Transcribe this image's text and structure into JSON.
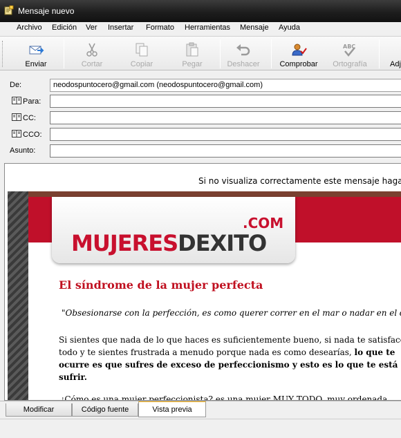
{
  "window": {
    "title": "Mensaje nuevo"
  },
  "menu": [
    "Archivo",
    "Edición",
    "Ver",
    "Insertar",
    "Formato",
    "Herramientas",
    "Mensaje",
    "Ayuda"
  ],
  "toolbar": {
    "send": "Enviar",
    "cut": "Cortar",
    "copy": "Copiar",
    "paste": "Pegar",
    "undo": "Deshacer",
    "check": "Comprobar",
    "spelling": "Ortografía",
    "attach": "Adj"
  },
  "headers": {
    "from_label": "De:",
    "from_value": "neodospuntocero@gmail.com     (neodospuntocero@gmail.com)",
    "to_label": "Para:",
    "cc_label": "CC:",
    "bcc_label": "CCO:",
    "subject_label": "Asunto:"
  },
  "body": {
    "notice": "Si no visualiza correctamente este mensaje haga",
    "logo_main_a": "MUJERES",
    "logo_main_b": "DEXITO",
    "logo_com": ".COM",
    "title": "El síndrome de la mujer perfecta",
    "quote": "\"Obsesionarse con la perfección, es como querer correr en el mar o nadar en el desierto",
    "p1_l1": "Si sientes que nada de lo que haces es suficientemente bueno, si nada te satisface o",
    "p1_l2a": "todo y te sientes frustrada a menudo porque nada es como desearías, ",
    "p1_l2b": "lo que te",
    "p1_l3": "ocurre es que sufres de exceso de perfeccionismo y esto es lo que te está haciendo",
    "p1_l4": "sufrir.",
    "p2": "¿Cómo es una mujer perfeccionista? es una mujer MUY TODO, muy ordenada"
  },
  "tabs": [
    "Modificar",
    "Código fuente",
    "Vista previa"
  ],
  "colors": {
    "accent_red": "#c0102a",
    "title_red": "#c01020",
    "tab_active": "#e8a000"
  }
}
